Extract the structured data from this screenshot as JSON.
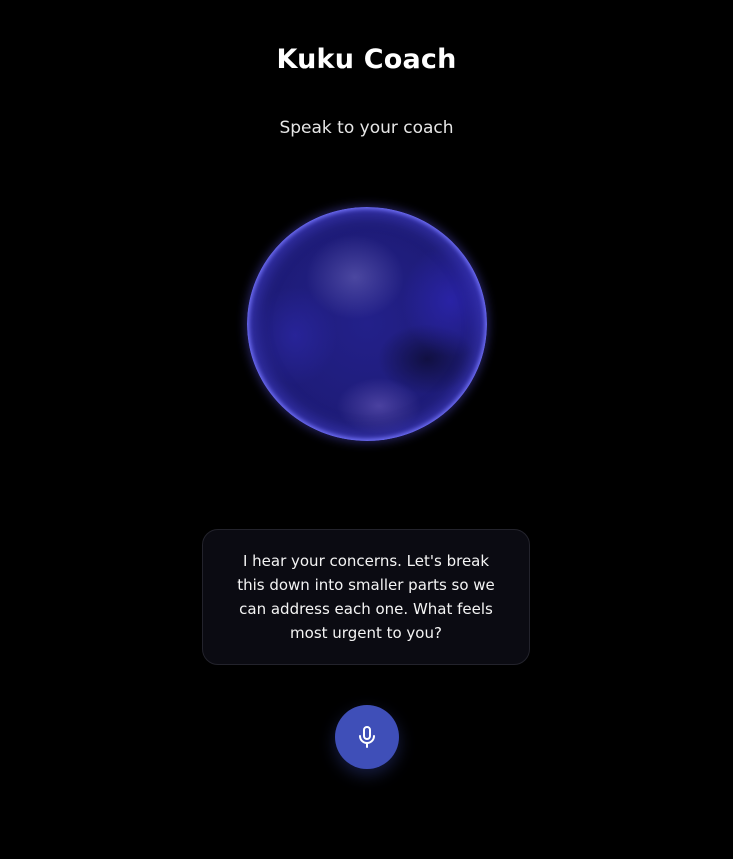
{
  "header": {
    "title": "Kuku Coach",
    "subtitle": "Speak to your coach"
  },
  "coach": {
    "message": "I hear your concerns. Let's break this down into smaller parts so we can address each one. What feels most urgent to you?"
  },
  "controls": {
    "mic_icon": "microphone-icon"
  },
  "colors": {
    "background": "#000000",
    "accent": "#3f4fb8",
    "orb": "#23208a",
    "card": "#0b0b12"
  }
}
